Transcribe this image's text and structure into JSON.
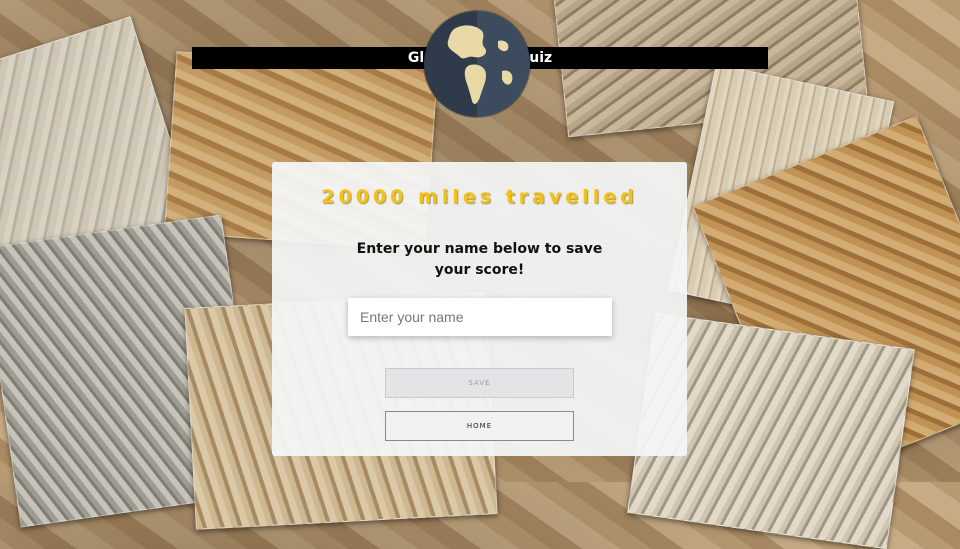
{
  "header": {
    "title": "Globe Trotter Quiz"
  },
  "icons": {
    "logo": "globe-icon"
  },
  "result": {
    "score_text": "20000 miles travelled"
  },
  "save_form": {
    "prompt": "Enter your name below to save your score!",
    "name_placeholder": "Enter your name",
    "name_value": ""
  },
  "buttons": {
    "save_label": "SAVE",
    "home_label": "HOME"
  },
  "colors": {
    "score_text": "#f2c218",
    "header_bar": "#000000",
    "card_bg": "#f4f6f8"
  },
  "state": {
    "save_disabled": true
  }
}
